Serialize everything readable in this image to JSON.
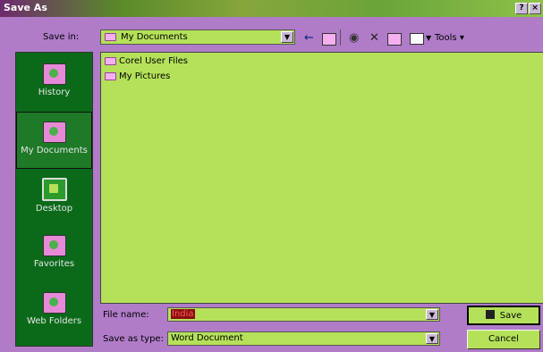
{
  "window": {
    "title": "Save As",
    "help_label": "?",
    "close_label": "×"
  },
  "save_in": {
    "label": "Save in:",
    "value": "My Documents",
    "arrow": "▼"
  },
  "toolbar": {
    "tools_label": "Tools",
    "icons": [
      "back-arrow-icon",
      "up-folder-icon",
      "search-web-icon",
      "delete-icon",
      "new-folder-icon",
      "views-icon"
    ]
  },
  "places": [
    {
      "label": "History",
      "icon": "history-icon"
    },
    {
      "label": "My Documents",
      "icon": "my-documents-icon",
      "selected": true
    },
    {
      "label": "Desktop",
      "icon": "desktop-icon"
    },
    {
      "label": "Favorites",
      "icon": "favorites-icon"
    },
    {
      "label": "Web Folders",
      "icon": "web-folders-icon"
    }
  ],
  "files": [
    {
      "name": "Corel User Files",
      "type": "folder"
    },
    {
      "name": "My Pictures",
      "type": "folder"
    }
  ],
  "file_name": {
    "label": "File name:",
    "value": "India"
  },
  "save_as_type": {
    "label": "Save as type:",
    "value": "Word Document"
  },
  "buttons": {
    "save": "Save",
    "cancel": "Cancel"
  },
  "colors": {
    "pane": "#b5e15a",
    "sidebar": "#0b6a1a",
    "frame": "#b07cc8",
    "highlight": "#8a0f0f"
  }
}
